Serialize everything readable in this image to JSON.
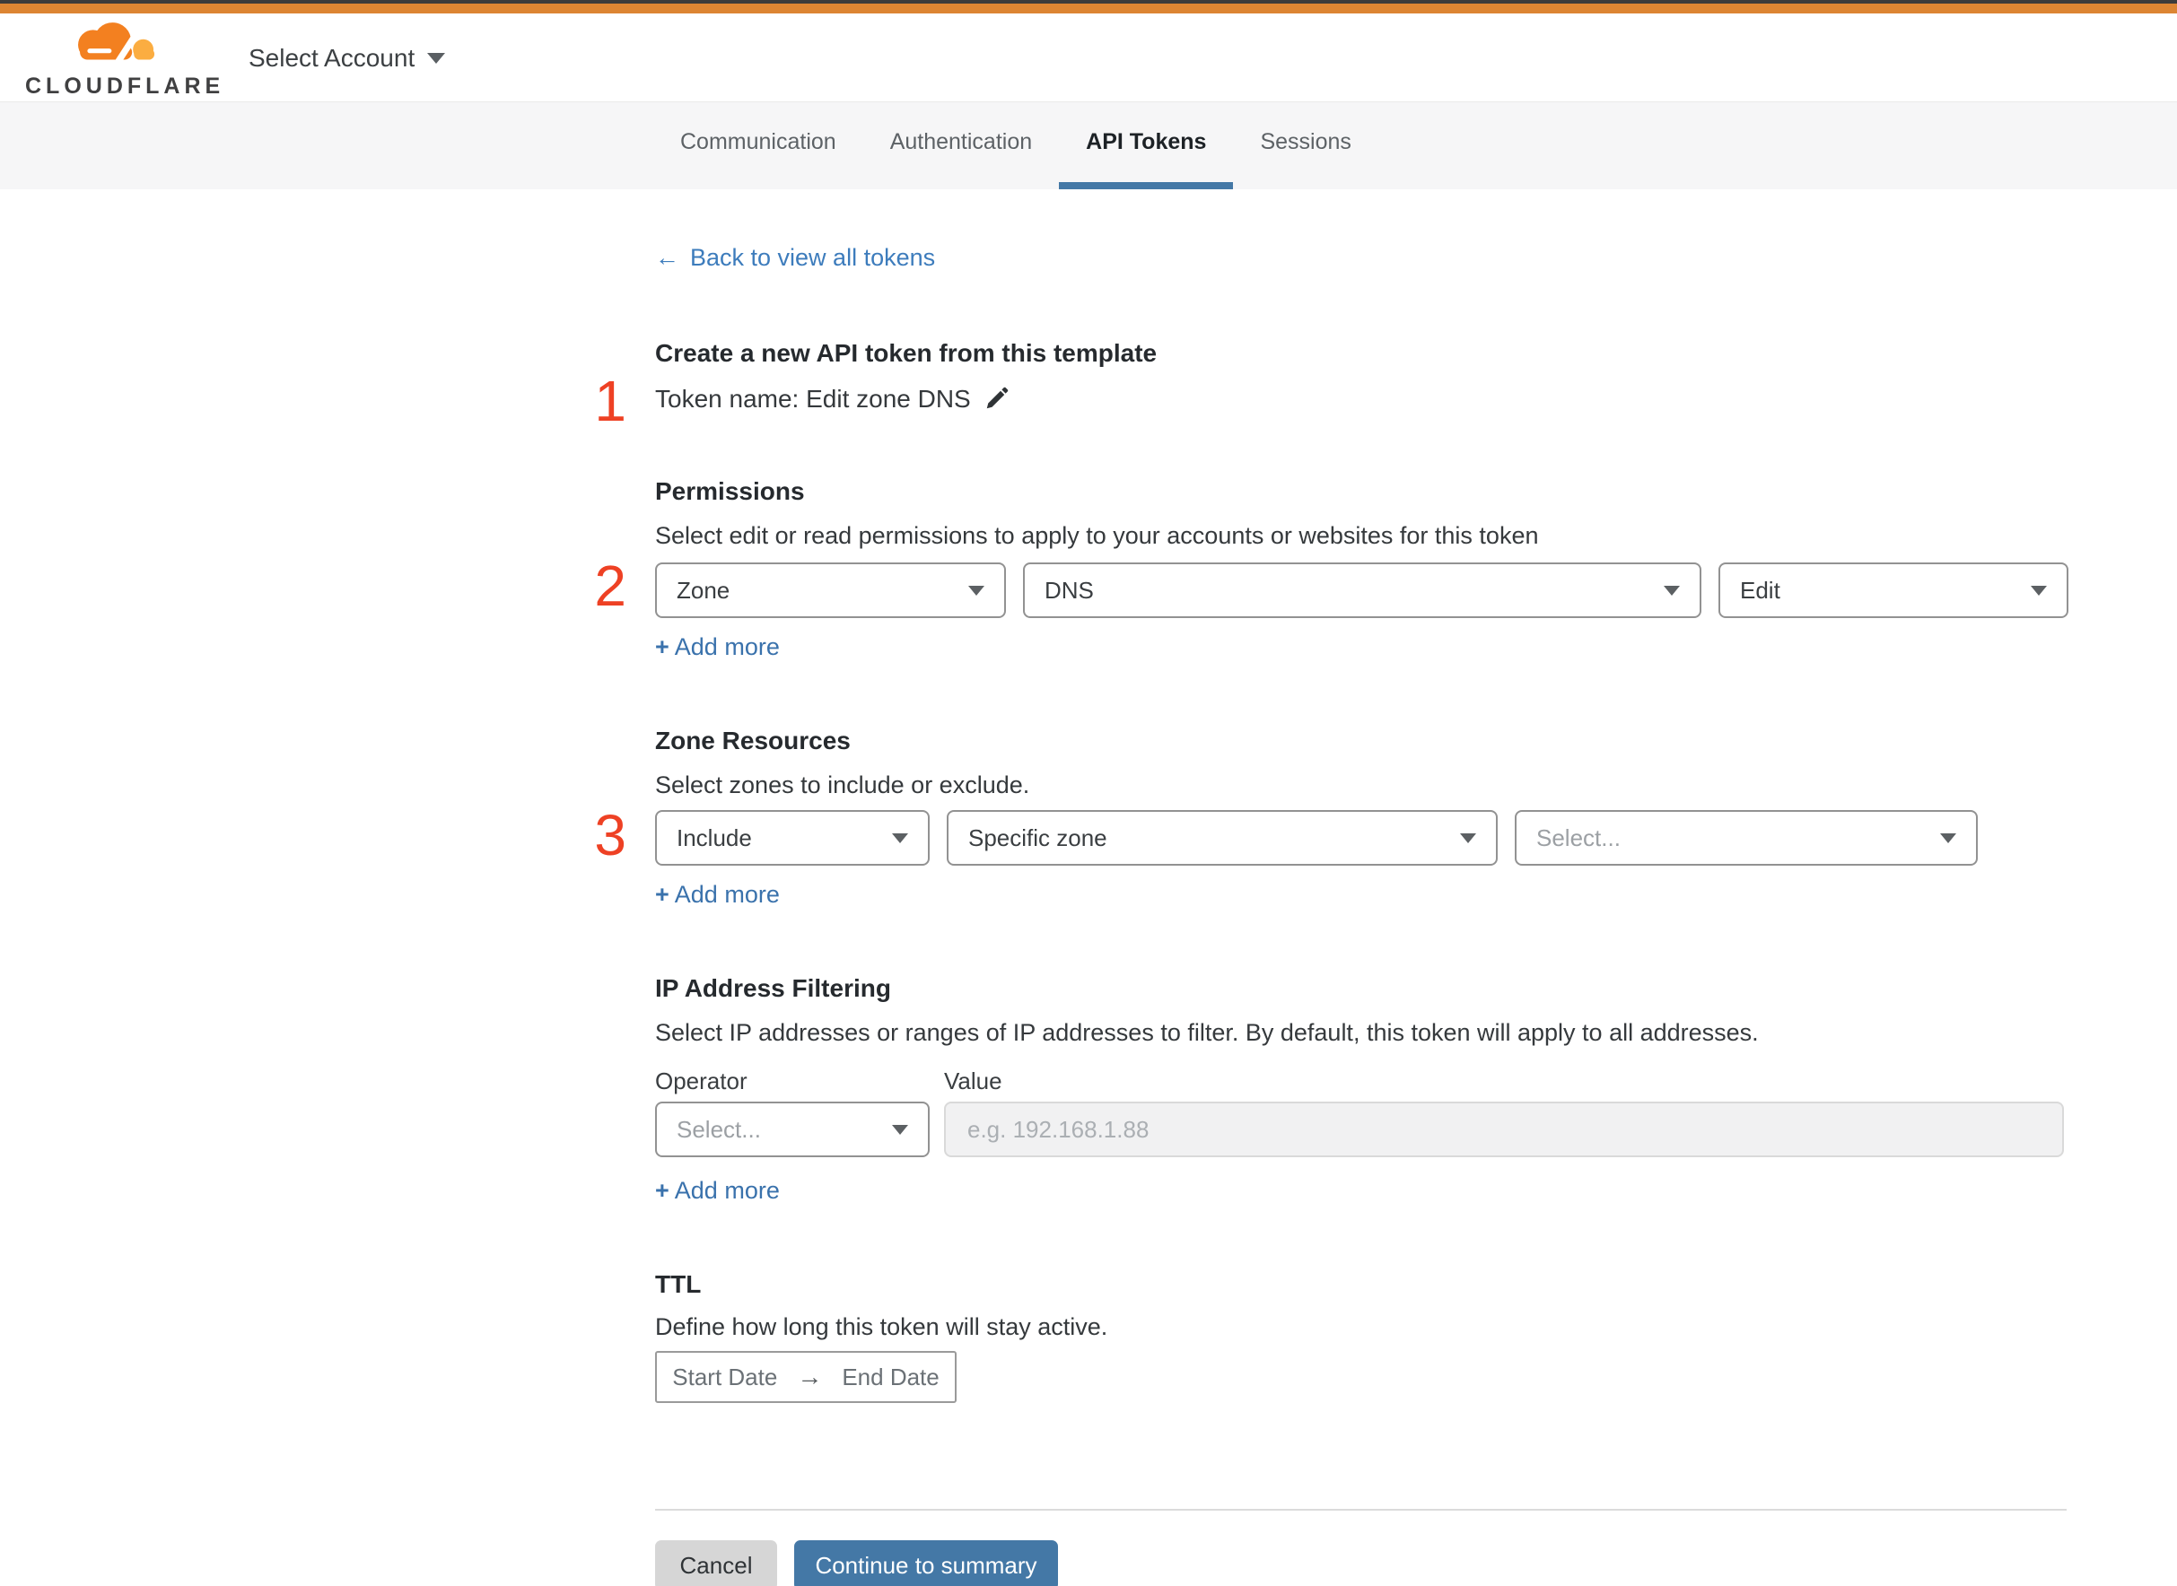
{
  "header": {
    "logo_text": "CLOUDFLARE",
    "account_selector": "Select Account"
  },
  "tabs": {
    "items": [
      {
        "label": "Communication",
        "active": false
      },
      {
        "label": "Authentication",
        "active": false
      },
      {
        "label": "API Tokens",
        "active": true
      },
      {
        "label": "Sessions",
        "active": false
      }
    ]
  },
  "main": {
    "back_link": {
      "arrow": "←",
      "label": "Back to view all tokens"
    },
    "token_section": {
      "number": "1",
      "title": "Create a new API token from this template",
      "token_name": "Token name: Edit zone DNS"
    },
    "permissions": {
      "number": "2",
      "title": "Permissions",
      "description": "Select edit or read permissions to apply to your accounts or websites for this token",
      "selects": [
        {
          "value": "Zone"
        },
        {
          "value": "DNS"
        },
        {
          "value": "Edit"
        }
      ],
      "add_more": {
        "plus": "+",
        "label": "Add more"
      }
    },
    "zone_resources": {
      "number": "3",
      "title": "Zone Resources",
      "description": "Select zones to include or exclude.",
      "selects": [
        {
          "value": "Include"
        },
        {
          "value": "Specific zone"
        },
        {
          "value": "Select..."
        }
      ],
      "add_more": {
        "plus": "+",
        "label": "Add more"
      }
    },
    "ip_filtering": {
      "title": "IP Address Filtering",
      "description": "Select IP addresses or ranges of IP addresses to filter. By default, this token will apply to all addresses.",
      "operator_label": "Operator",
      "value_label": "Value",
      "operator_select": "Select...",
      "value_placeholder": "e.g. 192.168.1.88",
      "add_more": {
        "plus": "+",
        "label": "Add more"
      }
    },
    "ttl": {
      "title": "TTL",
      "description": "Define how long this token will stay active.",
      "start_date": "Start Date",
      "arrow": "→",
      "end_date": "End Date"
    },
    "footer": {
      "cancel": "Cancel",
      "continue": "Continue to summary"
    }
  },
  "colors": {
    "top_bar_orange": "#dc8533",
    "logo_orange": "#f38020",
    "logo_orange_light": "#fbad41",
    "step_number_red": "#ee4124",
    "link_blue": "#3d7cbc",
    "add_more_blue": "#3a72ac",
    "tab_underline_blue": "#4478a6",
    "primary_button_blue": "#4478a6",
    "cancel_gray": "#d6d6d6",
    "tabbar_background": "#f6f6f7"
  }
}
